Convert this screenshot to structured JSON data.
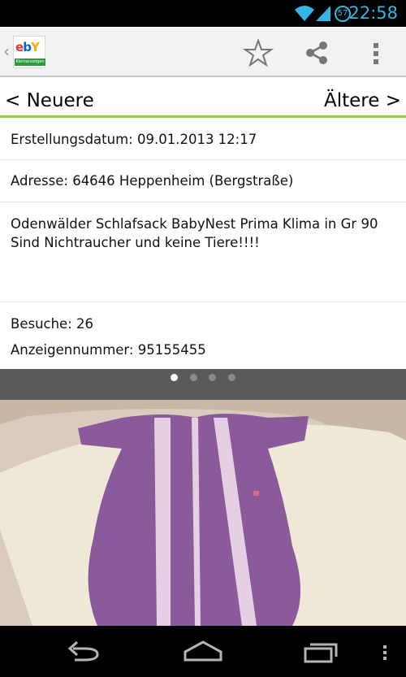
{
  "status_bar": {
    "time": "22:58",
    "battery_level": "57"
  },
  "action_bar": {
    "logo_text": "ebY",
    "logo_subtitle": "Kleinanzeigen"
  },
  "navigation": {
    "newer_label": "< Neuere",
    "older_label": "Ältere >"
  },
  "details": {
    "created": "Erstellungsdatum: 09.01.2013 12:17",
    "address": "Adresse: 64646 Heppenheim (Bergstraße)",
    "description_line1": "Odenwälder Schlafsack BabyNest Prima Klima in Gr 90",
    "description_line2": "Sind Nichtraucher und keine Tiere!!!!",
    "visits": "Besuche: 26",
    "ad_number": "Anzeigennummer: 95155455"
  },
  "gallery": {
    "image_count": 4,
    "active_index": 0
  },
  "colors": {
    "accent_green": "#99cc33",
    "status_blue": "#33b5e5",
    "sack_purple": "#8a5a9a"
  },
  "icons": [
    "wifi-icon",
    "signal-icon",
    "star-icon",
    "share-icon",
    "overflow-icon",
    "back-icon",
    "home-icon",
    "recents-icon",
    "menu-icon"
  ]
}
